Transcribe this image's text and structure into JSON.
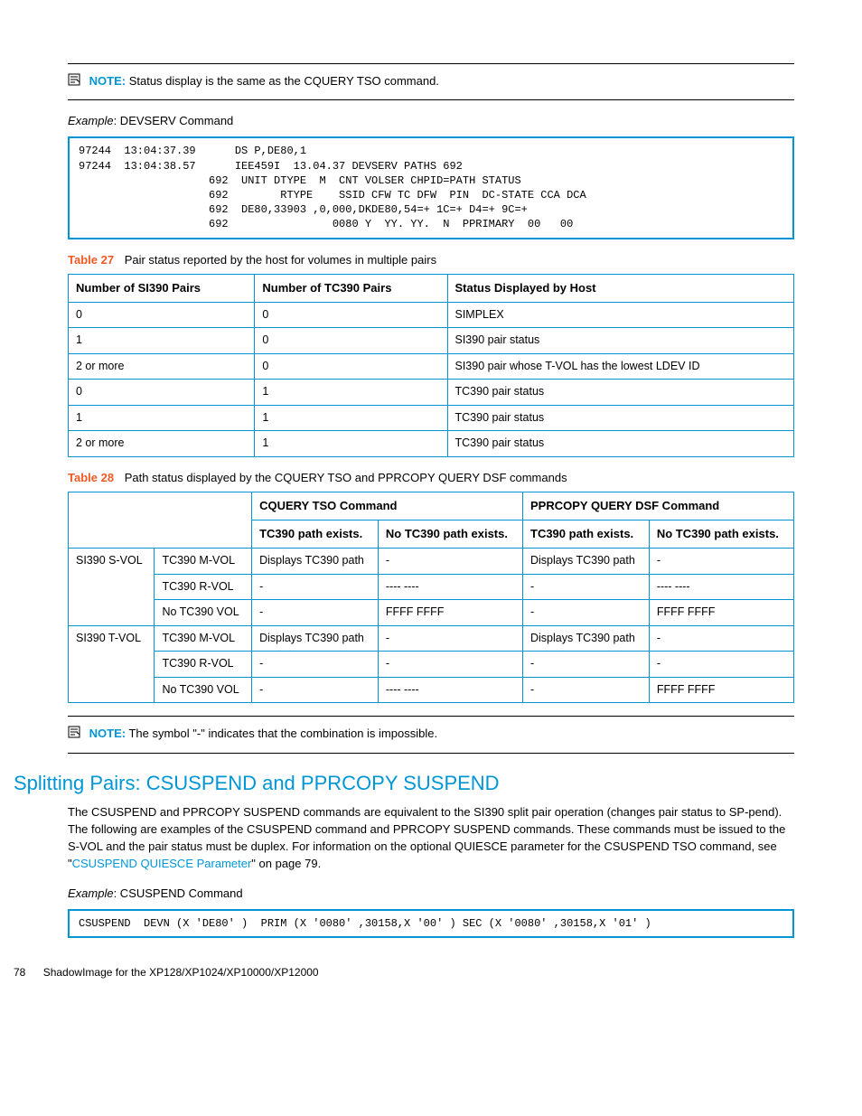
{
  "note1": {
    "label": "NOTE:",
    "text": "Status display is the same as the CQUERY TSO command."
  },
  "example1": {
    "prefix": "Example",
    "title": ": DEVSERV Command",
    "code": "97244  13:04:37.39      DS P,DE80,1\n97244  13:04:38.57      IEE459I  13.04.37 DEVSERV PATHS 692\n                    692  UNIT DTYPE  M  CNT VOLSER CHPID=PATH STATUS\n                    692        RTYPE    SSID CFW TC DFW  PIN  DC-STATE CCA DCA\n                    692  DE80,33903 ,0,000,DKDE80,54=+ 1C=+ D4=+ 9C=+\n                    692                0080 Y  YY. YY.  N  PPRIMARY  00   00"
  },
  "table27": {
    "label": "Table 27",
    "caption": "Pair status reported by the host for volumes in multiple pairs",
    "headers": [
      "Number of SI390 Pairs",
      "Number of TC390 Pairs",
      "Status Displayed by Host"
    ],
    "rows": [
      [
        "0",
        "0",
        "SIMPLEX"
      ],
      [
        "1",
        "0",
        "SI390 pair status"
      ],
      [
        "2 or more",
        "0",
        "SI390 pair whose T-VOL has the lowest LDEV ID"
      ],
      [
        "0",
        "1",
        "TC390 pair status"
      ],
      [
        "1",
        "1",
        "TC390 pair status"
      ],
      [
        "2 or more",
        "1",
        "TC390 pair status"
      ]
    ]
  },
  "table28": {
    "label": "Table 28",
    "caption": "Path status displayed by the CQUERY TSO and PPRCOPY QUERY DSF commands",
    "top_headers": [
      "CQUERY TSO Command",
      "PPRCOPY QUERY DSF Command"
    ],
    "sub_headers": [
      "TC390 path exists.",
      "No TC390 path exists.",
      "TC390 path exists.",
      "No TC390 path exists."
    ],
    "group1": "SI390 S-VOL",
    "group2": "SI390 T-VOL",
    "rows1": [
      [
        "TC390 M-VOL",
        "Displays TC390 path",
        "-",
        "Displays TC390 path",
        "-"
      ],
      [
        "TC390 R-VOL",
        "-",
        "---- ----",
        "-",
        "---- ----"
      ],
      [
        "No TC390 VOL",
        "-",
        "FFFF FFFF",
        "-",
        "FFFF FFFF"
      ]
    ],
    "rows2": [
      [
        "TC390 M-VOL",
        "Displays TC390 path",
        "-",
        "Displays TC390 path",
        "-"
      ],
      [
        "TC390 R-VOL",
        "-",
        "-",
        "-",
        "-"
      ],
      [
        "No TC390 VOL",
        "-",
        "---- ----",
        "-",
        "FFFF FFFF"
      ]
    ]
  },
  "note2": {
    "label": "NOTE:",
    "text": "The symbol \"-\" indicates that the combination is impossible."
  },
  "section": {
    "title": "Splitting Pairs: CSUSPEND and PPRCOPY SUSPEND",
    "para_pre": "The CSUSPEND and PPRCOPY SUSPEND commands are equivalent to the SI390 split pair operation (changes pair status to SP-pend). The following are examples of the CSUSPEND command and PPRCOPY SUSPEND commands. These commands must be issued to the S-VOL and the pair status must be duplex. For information on the optional QUIESCE parameter for the CSUSPEND TSO command, see \"",
    "link": "CSUSPEND QUIESCE Parameter",
    "para_post": "\" on page 79."
  },
  "example2": {
    "prefix": "Example",
    "title": ": CSUSPEND Command",
    "code": "CSUSPEND  DEVN (X 'DE80' )  PRIM (X '0080' ,30158,X '00' ) SEC (X '0080' ,30158,X '01' )"
  },
  "footer": {
    "page": "78",
    "text": "ShadowImage for the XP128/XP1024/XP10000/XP12000"
  }
}
